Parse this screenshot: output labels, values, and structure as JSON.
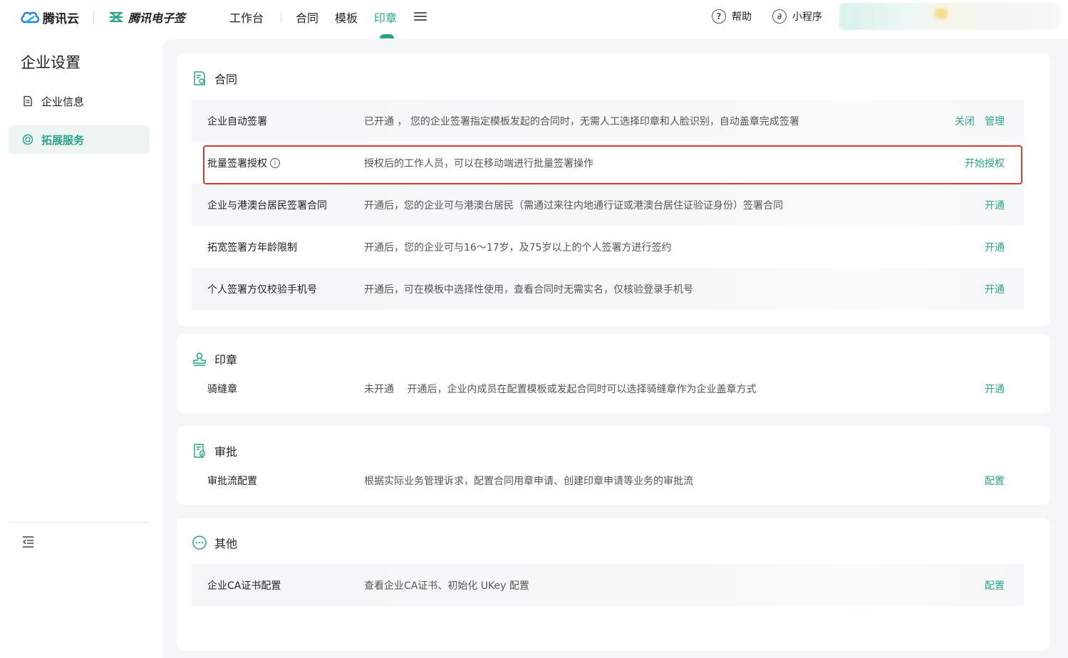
{
  "topbar": {
    "brand": "腾讯云",
    "product": "腾讯电子签",
    "nav": [
      "工作台",
      "合同",
      "模板",
      "印章"
    ],
    "active_nav": "印章",
    "help": "帮助",
    "mini_program": "小程序",
    "help_icon": "?",
    "mini_icon": "∂"
  },
  "sidebar": {
    "title": "企业设置",
    "items": [
      {
        "label": "企业信息",
        "icon": "document-icon"
      },
      {
        "label": "拓展服务",
        "icon": "service-icon"
      }
    ]
  },
  "sections": {
    "contract": {
      "title": "合同",
      "rows": [
        {
          "name": "企业自动签署",
          "desc": "已开通 ， 您的企业签署指定模板发起的合同时，无需人工选择印章和人脸识别，自动盖章完成签署",
          "actions": [
            "关闭",
            "管理"
          ]
        },
        {
          "name": "批量签署授权",
          "desc": "授权后的工作人员，可以在移动端进行批量签署操作",
          "actions": [
            "开始授权"
          ]
        },
        {
          "name": "企业与港澳台居民签署合同",
          "desc": "开通后，您的企业可与港澳台居民（需通过来往内地通行证或港澳台居住证验证身份）签署合同",
          "actions": [
            "开通"
          ]
        },
        {
          "name": "拓宽签署方年龄限制",
          "desc": "开通后，您的企业可与16～17岁，及75岁以上的个人签署方进行签约",
          "actions": [
            "开通"
          ]
        },
        {
          "name": "个人签署方仅校验手机号",
          "desc": "开通后，可在模板中选择性使用，查看合同时无需实名，仅核验登录手机号",
          "actions": [
            "开通"
          ]
        }
      ]
    },
    "seal": {
      "title": "印章",
      "row": {
        "name": "骑缝章",
        "desc": "未开通　 开通后，企业内成员在配置模板或发起合同时可以选择骑缝章作为企业盖章方式",
        "action": "开通"
      }
    },
    "approval": {
      "title": "审批",
      "row": {
        "name": "审批流配置",
        "desc": "根据实际业务管理诉求，配置合同用章申请、创建印章申请等业务的审批流",
        "action": "配置"
      }
    },
    "other": {
      "title": "其他",
      "row": {
        "name": "企业CA证书配置",
        "desc": "查看企业CA证书、初始化 UKey 配置",
        "action": "配置"
      }
    }
  },
  "colors": {
    "accent": "#2aa38b",
    "highlight": "#d93a2b"
  }
}
